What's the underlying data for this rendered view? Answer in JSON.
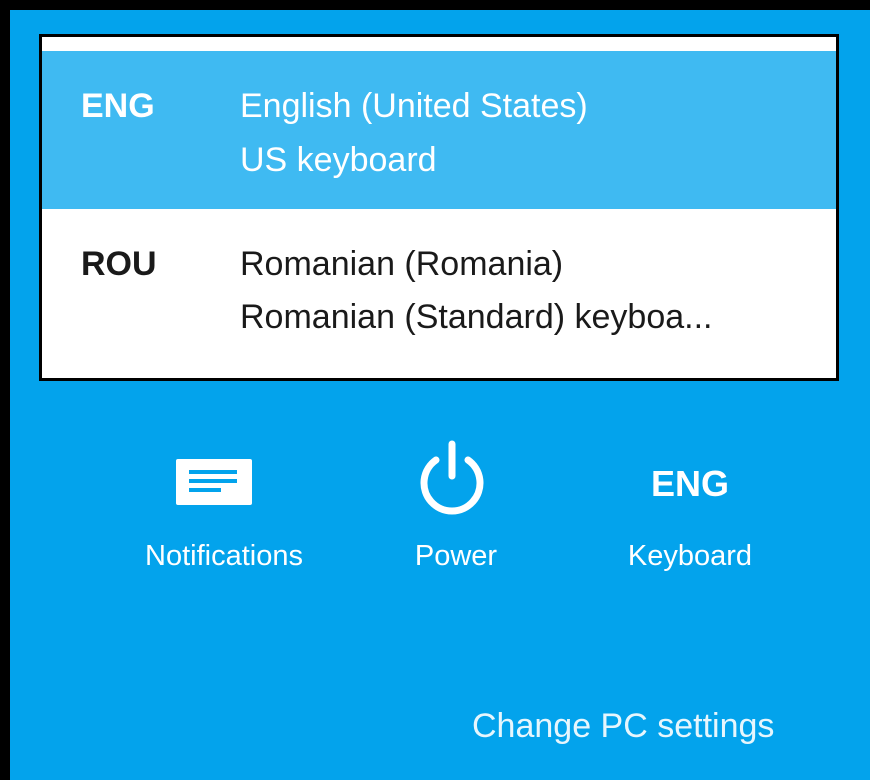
{
  "languages": [
    {
      "code": "ENG",
      "name": "English (United States)",
      "layout": "US keyboard",
      "selected": true
    },
    {
      "code": "ROU",
      "name": "Romanian (Romania)",
      "layout": "Romanian (Standard) keyboa...",
      "selected": false
    }
  ],
  "quick_actions": {
    "notifications": {
      "label": "Notifications",
      "icon": "notifications-icon"
    },
    "power": {
      "label": "Power",
      "icon": "power-icon"
    },
    "keyboard": {
      "label": "Keyboard",
      "code": "ENG"
    }
  },
  "change_pc_settings": "Change PC settings",
  "colors": {
    "panel_background": "#03a3ec",
    "selected_item": "#3fbaf2",
    "popup_border": "#000000",
    "text_light": "#ffffff",
    "text_dark": "#1a1a1a"
  }
}
